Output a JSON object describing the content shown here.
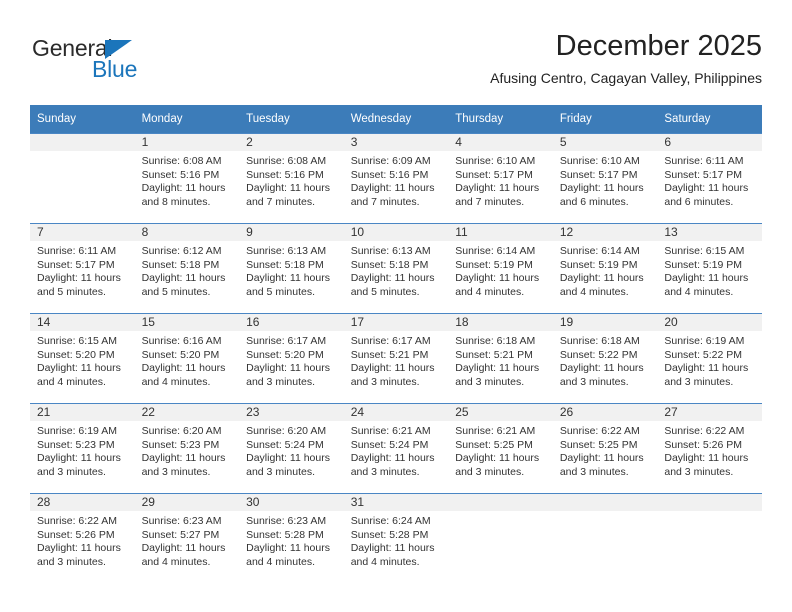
{
  "logo": {
    "word_dark": "General",
    "word_blue": "Blue",
    "triangle_color": "#1b75bb"
  },
  "header": {
    "title": "December 2025",
    "subtitle": "Afusing Centro, Cagayan Valley, Philippines"
  },
  "theme": {
    "header_blue": "#3c7cb9",
    "row_divider_blue": "#4a86c4",
    "daynum_bg": "#f1f1f1",
    "text": "#333333"
  },
  "weekdays": [
    "Sunday",
    "Monday",
    "Tuesday",
    "Wednesday",
    "Thursday",
    "Friday",
    "Saturday"
  ],
  "weeks": [
    [
      {
        "day": "",
        "lines": []
      },
      {
        "day": "1",
        "lines": [
          "Sunrise: 6:08 AM",
          "Sunset: 5:16 PM",
          "Daylight: 11 hours",
          "and 8 minutes."
        ]
      },
      {
        "day": "2",
        "lines": [
          "Sunrise: 6:08 AM",
          "Sunset: 5:16 PM",
          "Daylight: 11 hours",
          "and 7 minutes."
        ]
      },
      {
        "day": "3",
        "lines": [
          "Sunrise: 6:09 AM",
          "Sunset: 5:16 PM",
          "Daylight: 11 hours",
          "and 7 minutes."
        ]
      },
      {
        "day": "4",
        "lines": [
          "Sunrise: 6:10 AM",
          "Sunset: 5:17 PM",
          "Daylight: 11 hours",
          "and 7 minutes."
        ]
      },
      {
        "day": "5",
        "lines": [
          "Sunrise: 6:10 AM",
          "Sunset: 5:17 PM",
          "Daylight: 11 hours",
          "and 6 minutes."
        ]
      },
      {
        "day": "6",
        "lines": [
          "Sunrise: 6:11 AM",
          "Sunset: 5:17 PM",
          "Daylight: 11 hours",
          "and 6 minutes."
        ]
      }
    ],
    [
      {
        "day": "7",
        "lines": [
          "Sunrise: 6:11 AM",
          "Sunset: 5:17 PM",
          "Daylight: 11 hours",
          "and 5 minutes."
        ]
      },
      {
        "day": "8",
        "lines": [
          "Sunrise: 6:12 AM",
          "Sunset: 5:18 PM",
          "Daylight: 11 hours",
          "and 5 minutes."
        ]
      },
      {
        "day": "9",
        "lines": [
          "Sunrise: 6:13 AM",
          "Sunset: 5:18 PM",
          "Daylight: 11 hours",
          "and 5 minutes."
        ]
      },
      {
        "day": "10",
        "lines": [
          "Sunrise: 6:13 AM",
          "Sunset: 5:18 PM",
          "Daylight: 11 hours",
          "and 5 minutes."
        ]
      },
      {
        "day": "11",
        "lines": [
          "Sunrise: 6:14 AM",
          "Sunset: 5:19 PM",
          "Daylight: 11 hours",
          "and 4 minutes."
        ]
      },
      {
        "day": "12",
        "lines": [
          "Sunrise: 6:14 AM",
          "Sunset: 5:19 PM",
          "Daylight: 11 hours",
          "and 4 minutes."
        ]
      },
      {
        "day": "13",
        "lines": [
          "Sunrise: 6:15 AM",
          "Sunset: 5:19 PM",
          "Daylight: 11 hours",
          "and 4 minutes."
        ]
      }
    ],
    [
      {
        "day": "14",
        "lines": [
          "Sunrise: 6:15 AM",
          "Sunset: 5:20 PM",
          "Daylight: 11 hours",
          "and 4 minutes."
        ]
      },
      {
        "day": "15",
        "lines": [
          "Sunrise: 6:16 AM",
          "Sunset: 5:20 PM",
          "Daylight: 11 hours",
          "and 4 minutes."
        ]
      },
      {
        "day": "16",
        "lines": [
          "Sunrise: 6:17 AM",
          "Sunset: 5:20 PM",
          "Daylight: 11 hours",
          "and 3 minutes."
        ]
      },
      {
        "day": "17",
        "lines": [
          "Sunrise: 6:17 AM",
          "Sunset: 5:21 PM",
          "Daylight: 11 hours",
          "and 3 minutes."
        ]
      },
      {
        "day": "18",
        "lines": [
          "Sunrise: 6:18 AM",
          "Sunset: 5:21 PM",
          "Daylight: 11 hours",
          "and 3 minutes."
        ]
      },
      {
        "day": "19",
        "lines": [
          "Sunrise: 6:18 AM",
          "Sunset: 5:22 PM",
          "Daylight: 11 hours",
          "and 3 minutes."
        ]
      },
      {
        "day": "20",
        "lines": [
          "Sunrise: 6:19 AM",
          "Sunset: 5:22 PM",
          "Daylight: 11 hours",
          "and 3 minutes."
        ]
      }
    ],
    [
      {
        "day": "21",
        "lines": [
          "Sunrise: 6:19 AM",
          "Sunset: 5:23 PM",
          "Daylight: 11 hours",
          "and 3 minutes."
        ]
      },
      {
        "day": "22",
        "lines": [
          "Sunrise: 6:20 AM",
          "Sunset: 5:23 PM",
          "Daylight: 11 hours",
          "and 3 minutes."
        ]
      },
      {
        "day": "23",
        "lines": [
          "Sunrise: 6:20 AM",
          "Sunset: 5:24 PM",
          "Daylight: 11 hours",
          "and 3 minutes."
        ]
      },
      {
        "day": "24",
        "lines": [
          "Sunrise: 6:21 AM",
          "Sunset: 5:24 PM",
          "Daylight: 11 hours",
          "and 3 minutes."
        ]
      },
      {
        "day": "25",
        "lines": [
          "Sunrise: 6:21 AM",
          "Sunset: 5:25 PM",
          "Daylight: 11 hours",
          "and 3 minutes."
        ]
      },
      {
        "day": "26",
        "lines": [
          "Sunrise: 6:22 AM",
          "Sunset: 5:25 PM",
          "Daylight: 11 hours",
          "and 3 minutes."
        ]
      },
      {
        "day": "27",
        "lines": [
          "Sunrise: 6:22 AM",
          "Sunset: 5:26 PM",
          "Daylight: 11 hours",
          "and 3 minutes."
        ]
      }
    ],
    [
      {
        "day": "28",
        "lines": [
          "Sunrise: 6:22 AM",
          "Sunset: 5:26 PM",
          "Daylight: 11 hours",
          "and 3 minutes."
        ]
      },
      {
        "day": "29",
        "lines": [
          "Sunrise: 6:23 AM",
          "Sunset: 5:27 PM",
          "Daylight: 11 hours",
          "and 4 minutes."
        ]
      },
      {
        "day": "30",
        "lines": [
          "Sunrise: 6:23 AM",
          "Sunset: 5:28 PM",
          "Daylight: 11 hours",
          "and 4 minutes."
        ]
      },
      {
        "day": "31",
        "lines": [
          "Sunrise: 6:24 AM",
          "Sunset: 5:28 PM",
          "Daylight: 11 hours",
          "and 4 minutes."
        ]
      },
      {
        "day": "",
        "lines": []
      },
      {
        "day": "",
        "lines": []
      },
      {
        "day": "",
        "lines": []
      }
    ]
  ]
}
